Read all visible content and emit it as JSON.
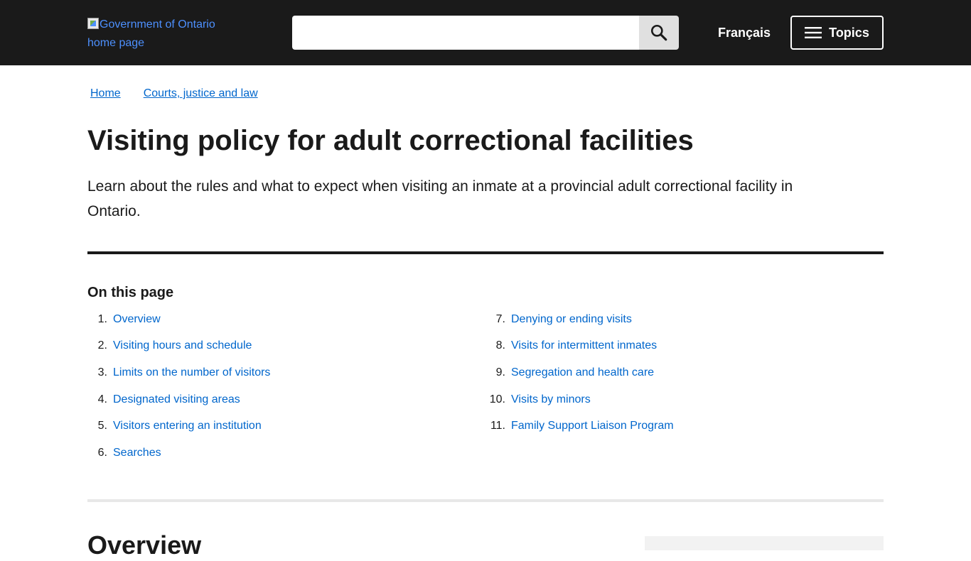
{
  "header": {
    "logo_alt": "Government of Ontario home page",
    "search": {
      "value": "",
      "placeholder": "",
      "button_icon": "search-icon"
    },
    "language_link": "Français",
    "topics_button": "Topics",
    "topics_icon": "menu-icon",
    "background_color": "#1a1a1a"
  },
  "breadcrumb": [
    {
      "label": "Home"
    },
    {
      "label": "Courts, justice and law"
    }
  ],
  "page": {
    "title": "Visiting policy for adult correctional facilities",
    "lead": "Learn about the rules and what to expect when visiting an inmate at a provincial adult correctional facility in Ontario."
  },
  "toc": {
    "heading": "On this page",
    "items": [
      {
        "num": "1.",
        "label": "Overview"
      },
      {
        "num": "2.",
        "label": "Visiting hours and schedule"
      },
      {
        "num": "3.",
        "label": "Limits on the number of visitors"
      },
      {
        "num": "4.",
        "label": "Designated visiting areas"
      },
      {
        "num": "5.",
        "label": "Visitors entering an institution"
      },
      {
        "num": "6.",
        "label": "Searches"
      },
      {
        "num": "7.",
        "label": "Denying or ending visits"
      },
      {
        "num": "8.",
        "label": "Visits for intermittent inmates"
      },
      {
        "num": "9.",
        "label": "Segregation and health care"
      },
      {
        "num": "10.",
        "label": "Visits by minors"
      },
      {
        "num": "11.",
        "label": "Family Support Liaison Program"
      }
    ]
  },
  "section": {
    "heading": "Overview"
  },
  "colors": {
    "link": "#0066cc",
    "text": "#1a1a1a",
    "divider_light": "#e8e8e8"
  }
}
